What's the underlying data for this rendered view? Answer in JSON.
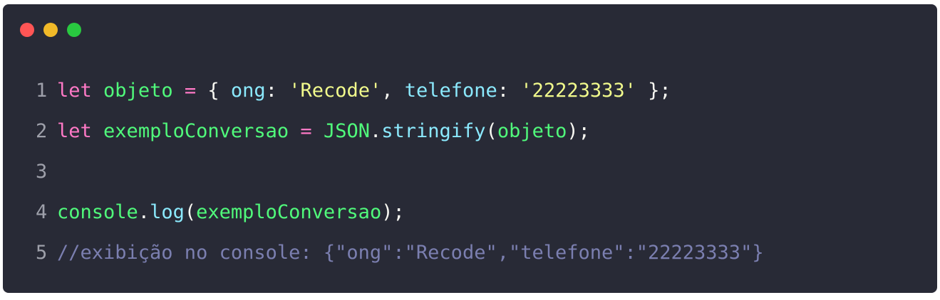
{
  "window": {
    "controls": [
      "close",
      "minimize",
      "maximize"
    ],
    "colors": {
      "close": "#ff5555",
      "minimize": "#f1b928",
      "maximize": "#29c940",
      "background": "#282a36"
    }
  },
  "code": {
    "lines": [
      {
        "number": "1",
        "tokens": [
          {
            "t": "let",
            "k": "kw"
          },
          {
            "t": " ",
            "k": "punc"
          },
          {
            "t": "objeto",
            "k": "var"
          },
          {
            "t": " ",
            "k": "punc"
          },
          {
            "t": "=",
            "k": "op"
          },
          {
            "t": " { ",
            "k": "punc"
          },
          {
            "t": "ong",
            "k": "prop"
          },
          {
            "t": ": ",
            "k": "punc"
          },
          {
            "t": "'Recode'",
            "k": "str"
          },
          {
            "t": ", ",
            "k": "punc"
          },
          {
            "t": "telefone",
            "k": "prop"
          },
          {
            "t": ": ",
            "k": "punc"
          },
          {
            "t": "'22223333'",
            "k": "str"
          },
          {
            "t": " };",
            "k": "punc"
          }
        ]
      },
      {
        "number": "2",
        "tokens": [
          {
            "t": "let",
            "k": "kw"
          },
          {
            "t": " ",
            "k": "punc"
          },
          {
            "t": "exemploConversao",
            "k": "var"
          },
          {
            "t": " ",
            "k": "punc"
          },
          {
            "t": "=",
            "k": "op"
          },
          {
            "t": " ",
            "k": "punc"
          },
          {
            "t": "JSON",
            "k": "var"
          },
          {
            "t": ".",
            "k": "punc"
          },
          {
            "t": "stringify",
            "k": "fn"
          },
          {
            "t": "(",
            "k": "punc"
          },
          {
            "t": "objeto",
            "k": "var"
          },
          {
            "t": ");",
            "k": "punc"
          }
        ]
      },
      {
        "number": "3",
        "tokens": []
      },
      {
        "number": "4",
        "tokens": [
          {
            "t": "console",
            "k": "var"
          },
          {
            "t": ".",
            "k": "punc"
          },
          {
            "t": "log",
            "k": "fn"
          },
          {
            "t": "(",
            "k": "punc"
          },
          {
            "t": "exemploConversao",
            "k": "var"
          },
          {
            "t": ");",
            "k": "punc"
          }
        ]
      },
      {
        "number": "5",
        "tokens": [
          {
            "t": "//exibição no console: {\"ong\":\"Recode\",\"telefone\":\"22223333\"}",
            "k": "cmt"
          }
        ]
      }
    ]
  }
}
